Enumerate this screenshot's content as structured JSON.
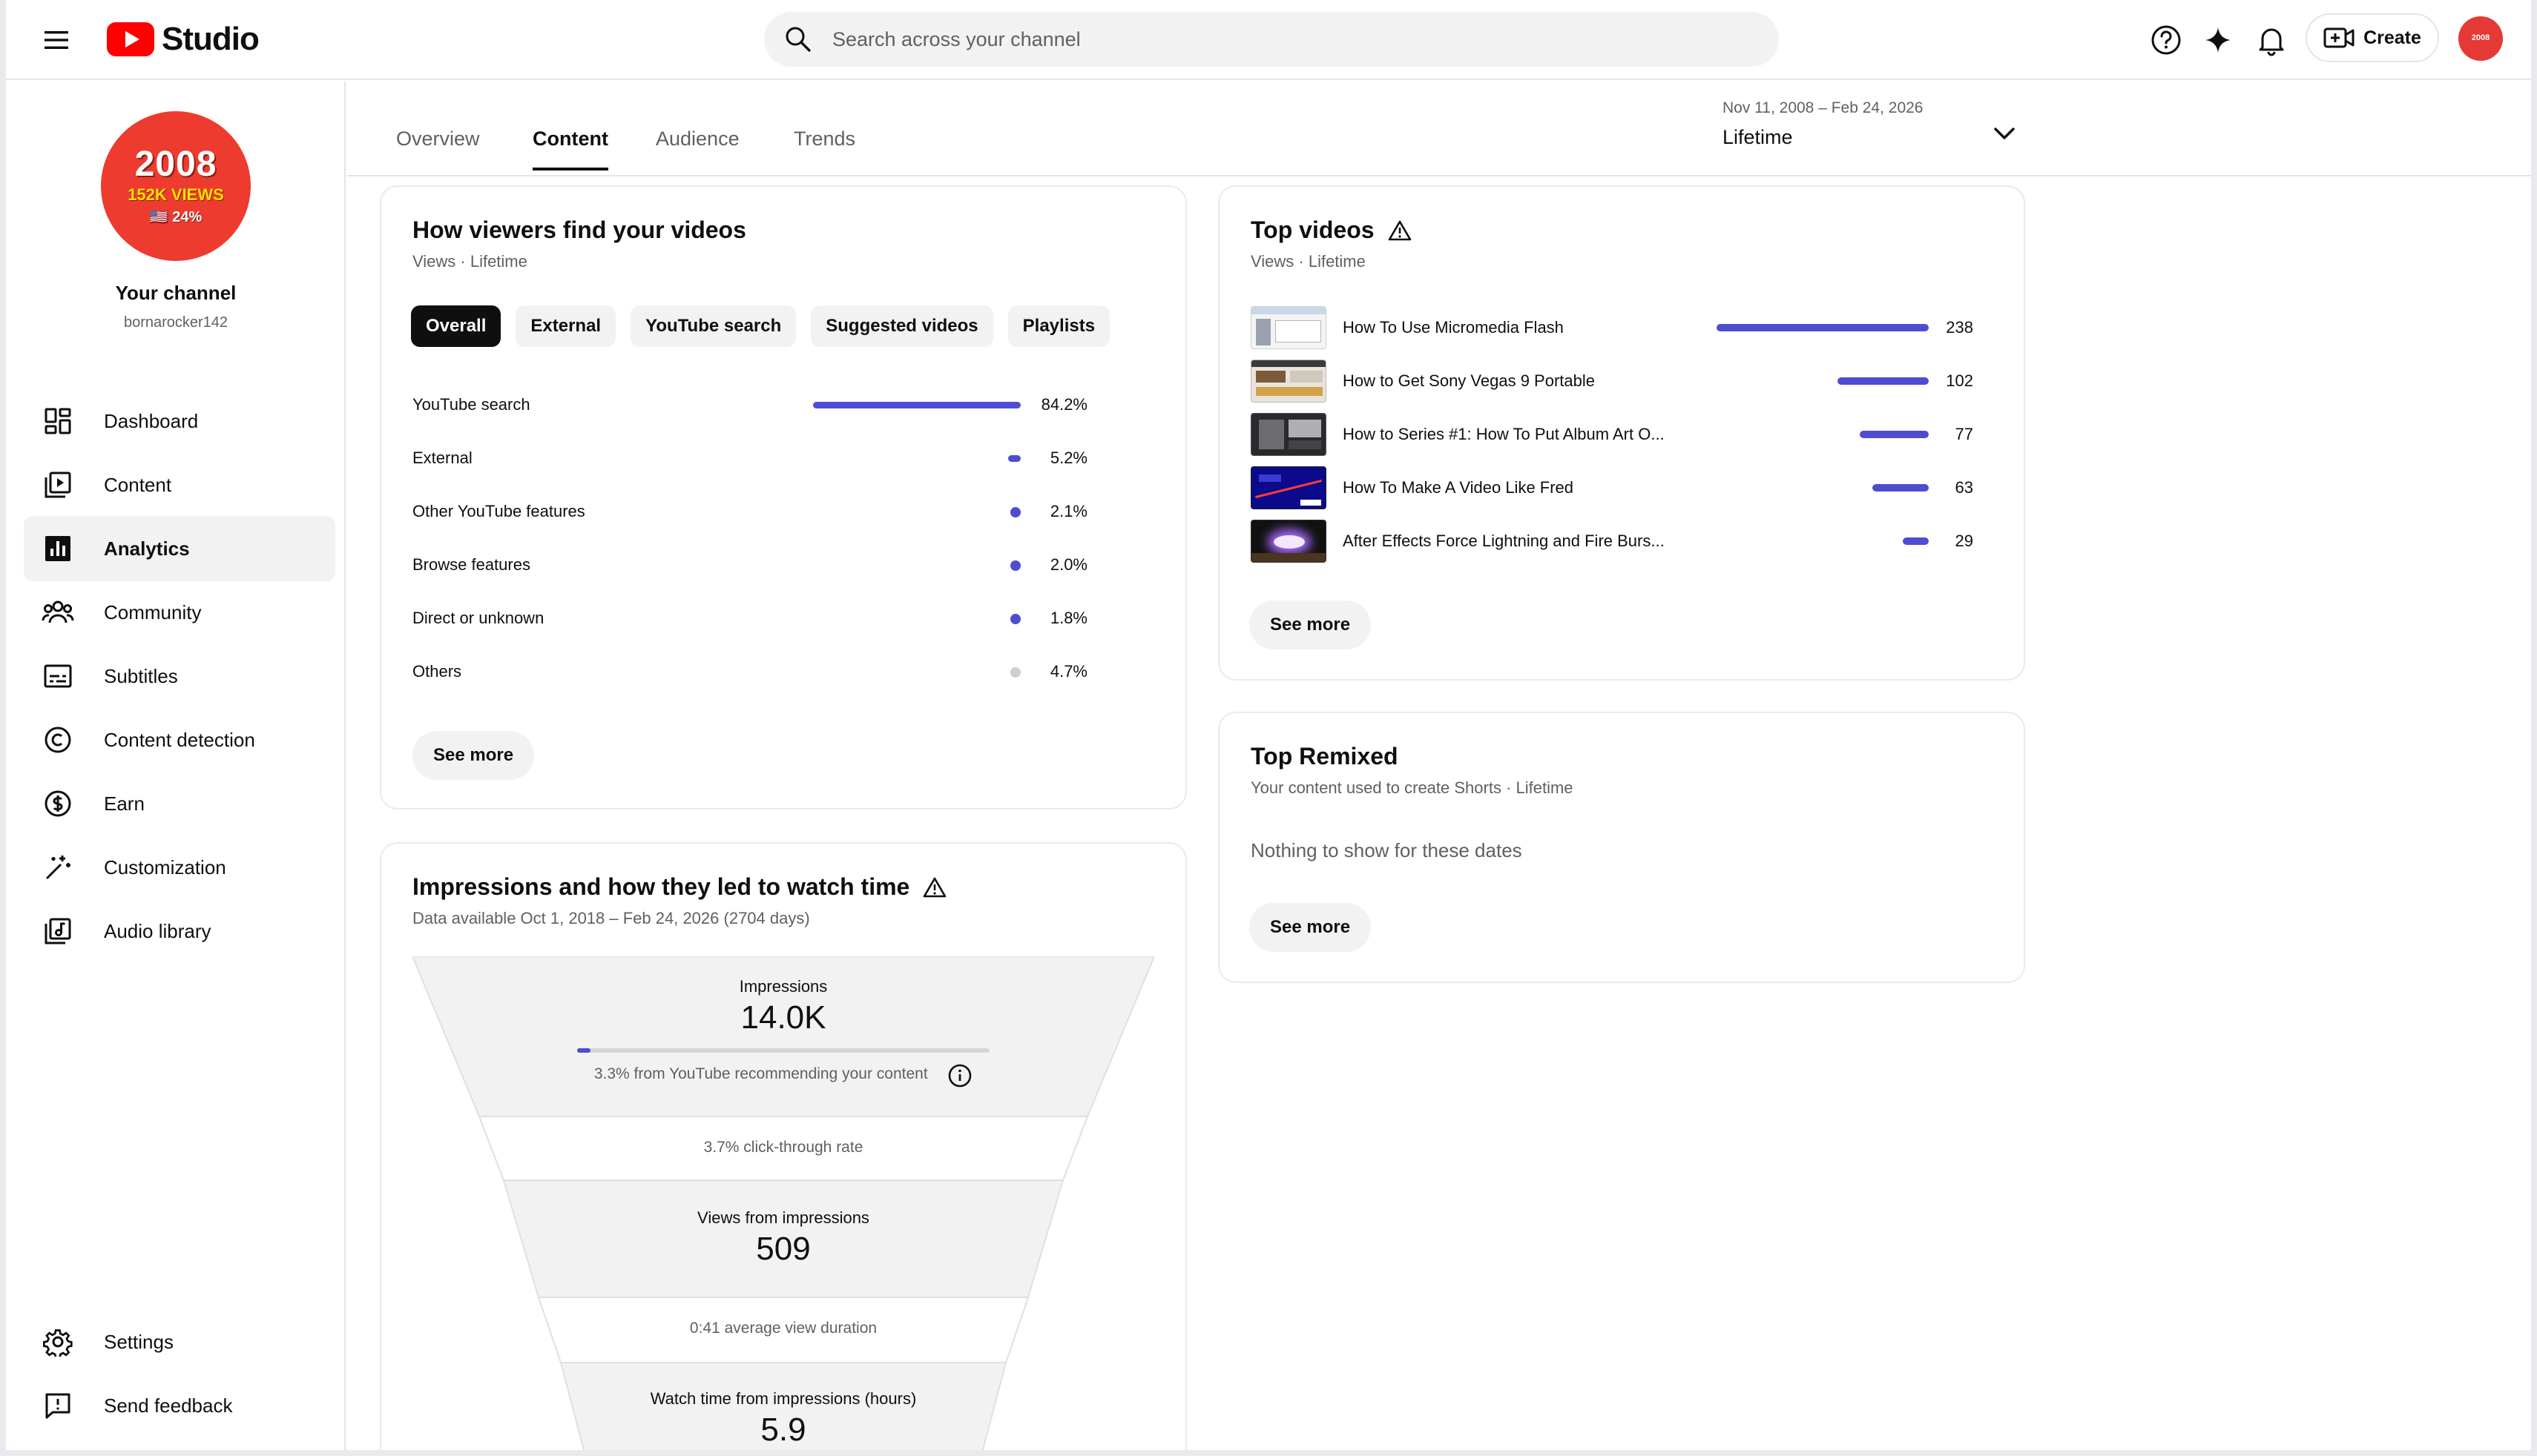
{
  "app": {
    "logo_text": "Studio",
    "search_placeholder": "Search across your channel",
    "create_label": "Create",
    "avatar_text": "2008"
  },
  "channel": {
    "avatar_year": "2008",
    "avatar_views": "152K VIEWS",
    "avatar_pct": "🇺🇸 24%",
    "name": "Your channel",
    "handle": "bornarocker142"
  },
  "nav": {
    "items": [
      {
        "label": "Dashboard",
        "icon": "dashboard-icon"
      },
      {
        "label": "Content",
        "icon": "content-icon"
      },
      {
        "label": "Analytics",
        "icon": "analytics-icon",
        "active": true
      },
      {
        "label": "Community",
        "icon": "community-icon"
      },
      {
        "label": "Subtitles",
        "icon": "subtitles-icon"
      },
      {
        "label": "Content detection",
        "icon": "copyright-icon"
      },
      {
        "label": "Earn",
        "icon": "dollar-icon"
      },
      {
        "label": "Customization",
        "icon": "magic-wand-icon"
      },
      {
        "label": "Audio library",
        "icon": "audio-library-icon"
      }
    ],
    "bottom": [
      {
        "label": "Settings",
        "icon": "gear-icon"
      },
      {
        "label": "Send feedback",
        "icon": "feedback-icon"
      }
    ]
  },
  "tabs": [
    "Overview",
    "Content",
    "Audience",
    "Trends"
  ],
  "active_tab": "Content",
  "date_range": {
    "range": "Nov 11, 2008 – Feb 24, 2026",
    "label": "Lifetime"
  },
  "traffic": {
    "title": "How viewers find your videos",
    "subtitle": "Views · Lifetime",
    "filters": [
      "Overall",
      "External",
      "YouTube search",
      "Suggested videos",
      "Playlists"
    ],
    "active_filter": "Overall",
    "rows": [
      {
        "label": "YouTube search",
        "value": "84.2%",
        "pct": 84.2
      },
      {
        "label": "External",
        "value": "5.2%",
        "pct": 5.2
      },
      {
        "label": "Other YouTube features",
        "value": "2.1%",
        "pct": 2.1
      },
      {
        "label": "Browse features",
        "value": "2.0%",
        "pct": 2.0
      },
      {
        "label": "Direct or unknown",
        "value": "1.8%",
        "pct": 1.8
      },
      {
        "label": "Others",
        "value": "4.7%",
        "pct": 4.7,
        "grey": true
      }
    ],
    "see_more": "See more"
  },
  "impressions": {
    "title": "Impressions and how they led to watch time",
    "subtitle": "Data available Oct 1, 2018 – Feb 24, 2026 (2704 days)",
    "impressions_label": "Impressions",
    "impressions_value": "14.0K",
    "recommend_note": "3.3% from YouTube recommending your content",
    "recommend_pct": 3.3,
    "ctr_note": "3.7% click-through rate",
    "views_label": "Views from impressions",
    "views_value": "509",
    "avd_note": "0:41 average view duration",
    "watch_label": "Watch time from impressions (hours)",
    "watch_value": "5.9"
  },
  "top_videos": {
    "title": "Top videos",
    "subtitle": "Views · Lifetime",
    "videos": [
      {
        "title": "How To Use Micromedia Flash",
        "views": "238",
        "n": 238
      },
      {
        "title": "How to Get Sony Vegas 9 Portable",
        "views": "102",
        "n": 102
      },
      {
        "title": "How to Series #1: How To Put Album Art O...",
        "views": "77",
        "n": 77
      },
      {
        "title": "How To Make A Video Like Fred",
        "views": "63",
        "n": 63
      },
      {
        "title": "After Effects Force Lightning and Fire Burs...",
        "views": "29",
        "n": 29
      }
    ],
    "see_more": "See more"
  },
  "top_remixed": {
    "title": "Top Remixed",
    "subtitle": "Your content used to create Shorts · Lifetime",
    "empty": "Nothing to show for these dates",
    "see_more": "See more"
  },
  "colors": {
    "accent_bar": "#4f4dcf",
    "youtube_red": "#ff0000"
  }
}
